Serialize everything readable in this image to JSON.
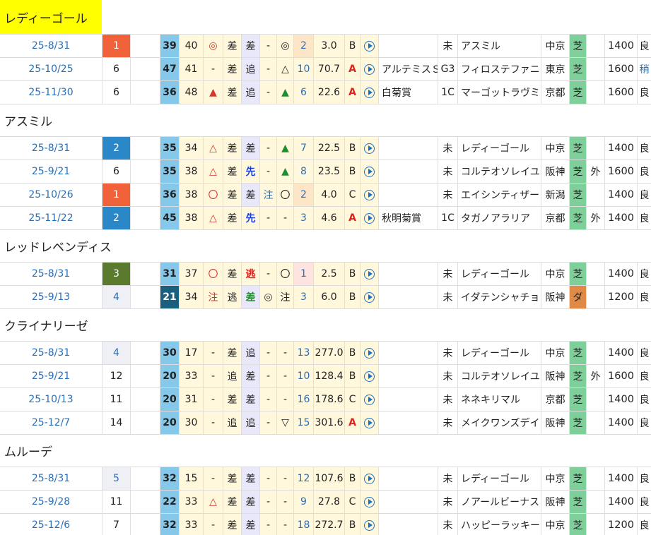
{
  "colors": {
    "rank_1": "#f2623a",
    "rank_2": "#2a87c8",
    "rank_3": "#5a7a2e",
    "rank_4_bg": "#eef0f5",
    "rank_5_bg": "#eef0f5",
    "idx_light": "#86c8ea",
    "idx_dark": "#1b5f7f",
    "turf": "#7fcf9a",
    "dirt": "#e08a45"
  },
  "groups": [
    {
      "name": "レディーゴール",
      "highlight": true,
      "rows": [
        {
          "date": "25-8/31",
          "rank": "1",
          "rank_style": "r1",
          "idx": "39",
          "idx_style": "light",
          "c2": "40",
          "m1": "◎",
          "m1c": "red",
          "m2": "差",
          "m3": "差",
          "m3c": "",
          "m4": "-",
          "m5": "◎",
          "m5c": "",
          "odds_rank": "2",
          "odds_bg": "peach",
          "odds": "3.0",
          "grade_letter": "B",
          "gl_red": false,
          "race": "",
          "cls": "未",
          "opponent": "アスミル",
          "venue": "中京",
          "surface": "芝",
          "surface_type": "turf",
          "course": "",
          "dist": "1400",
          "cond": "良"
        },
        {
          "date": "25-10/25",
          "rank": "6",
          "rank_style": "",
          "idx": "47",
          "idx_style": "light",
          "c2": "41",
          "m1": "-",
          "m1c": "",
          "m2": "差",
          "m3": "追",
          "m3c": "",
          "m4": "-",
          "m5": "△",
          "m5c": "",
          "odds_rank": "10",
          "odds_bg": "",
          "odds": "70.7",
          "grade_letter": "A",
          "gl_red": true,
          "race": "アルテミスＳ",
          "cls": "G3",
          "opponent": "フィロステファニ",
          "venue": "東京",
          "surface": "芝",
          "surface_type": "turf",
          "course": "",
          "dist": "1600",
          "cond": "稍"
        },
        {
          "date": "25-11/30",
          "rank": "6",
          "rank_style": "",
          "idx": "36",
          "idx_style": "light",
          "c2": "48",
          "m1": "▲",
          "m1c": "red",
          "m2": "差",
          "m3": "追",
          "m3c": "",
          "m4": "-",
          "m5": "▲",
          "m5c": "green",
          "odds_rank": "6",
          "odds_bg": "",
          "odds": "22.6",
          "grade_letter": "A",
          "gl_red": true,
          "race": "白菊賞",
          "cls": "1C",
          "opponent": "マーゴットラヴミー",
          "venue": "京都",
          "surface": "芝",
          "surface_type": "turf",
          "course": "",
          "dist": "1600",
          "cond": "良"
        }
      ]
    },
    {
      "name": "アスミル",
      "highlight": false,
      "rows": [
        {
          "date": "25-8/31",
          "rank": "2",
          "rank_style": "r2",
          "idx": "35",
          "idx_style": "light",
          "c2": "34",
          "m1": "△",
          "m1c": "red",
          "m2": "差",
          "m3": "差",
          "m3c": "",
          "m4": "-",
          "m5": "▲",
          "m5c": "green",
          "odds_rank": "7",
          "odds_bg": "",
          "odds": "22.5",
          "grade_letter": "B",
          "gl_red": false,
          "race": "",
          "cls": "未",
          "opponent": "レディーゴール",
          "venue": "中京",
          "surface": "芝",
          "surface_type": "turf",
          "course": "",
          "dist": "1400",
          "cond": "良"
        },
        {
          "date": "25-9/21",
          "rank": "6",
          "rank_style": "",
          "idx": "35",
          "idx_style": "light",
          "c2": "38",
          "m1": "△",
          "m1c": "red",
          "m2": "差",
          "m3": "先",
          "m3c": "blue",
          "m4": "-",
          "m5": "▲",
          "m5c": "green",
          "odds_rank": "8",
          "odds_bg": "",
          "odds": "23.5",
          "grade_letter": "B",
          "gl_red": false,
          "race": "",
          "cls": "未",
          "opponent": "コルテオソレイユ",
          "venue": "阪神",
          "surface": "芝",
          "surface_type": "turf",
          "course": "外",
          "dist": "1600",
          "cond": "良"
        },
        {
          "date": "25-10/26",
          "rank": "1",
          "rank_style": "r1",
          "idx": "36",
          "idx_style": "light",
          "c2": "38",
          "m1": "〇",
          "m1c": "red",
          "m2": "差",
          "m3": "差",
          "m3c": "",
          "m4": "注",
          "m5": "〇",
          "m5c": "",
          "odds_rank": "2",
          "odds_bg": "peach",
          "odds": "4.0",
          "grade_letter": "C",
          "gl_red": false,
          "race": "",
          "cls": "未",
          "opponent": "エイシンティザー",
          "venue": "新潟",
          "surface": "芝",
          "surface_type": "turf",
          "course": "",
          "dist": "1400",
          "cond": "良"
        },
        {
          "date": "25-11/22",
          "rank": "2",
          "rank_style": "r2",
          "idx": "45",
          "idx_style": "light",
          "c2": "38",
          "m1": "△",
          "m1c": "red",
          "m2": "差",
          "m3": "先",
          "m3c": "blue",
          "m4": "-",
          "m5": "-",
          "m5c": "",
          "odds_rank": "3",
          "odds_bg": "",
          "odds": "4.6",
          "grade_letter": "A",
          "gl_red": true,
          "race": "秋明菊賞",
          "cls": "1C",
          "opponent": "タガノアラリア",
          "venue": "京都",
          "surface": "芝",
          "surface_type": "turf",
          "course": "外",
          "dist": "1400",
          "cond": "良"
        }
      ]
    },
    {
      "name": "レッドレベンディス",
      "highlight": false,
      "rows": [
        {
          "date": "25-8/31",
          "rank": "3",
          "rank_style": "r3",
          "idx": "31",
          "idx_style": "light",
          "c2": "37",
          "m1": "〇",
          "m1c": "red",
          "m2": "差",
          "m3": "逃",
          "m3c": "boldred",
          "m4": "-",
          "m5": "〇",
          "m5c": "",
          "odds_rank": "1",
          "odds_bg": "pink",
          "odds": "2.5",
          "grade_letter": "B",
          "gl_red": false,
          "race": "",
          "cls": "未",
          "opponent": "レディーゴール",
          "venue": "中京",
          "surface": "芝",
          "surface_type": "turf",
          "course": "",
          "dist": "1400",
          "cond": "良"
        },
        {
          "date": "25-9/13",
          "rank": "4",
          "rank_style": "r4",
          "idx": "21",
          "idx_style": "dark",
          "c2": "34",
          "m1": "注",
          "m1c": "red",
          "m2": "逃",
          "m3": "差",
          "m3c": "boldgreen",
          "m4": "◎",
          "m5": "注",
          "m5c": "",
          "odds_rank": "3",
          "odds_bg": "",
          "odds": "6.0",
          "grade_letter": "B",
          "gl_red": false,
          "race": "",
          "cls": "未",
          "opponent": "イダテンシャチョウ",
          "venue": "阪神",
          "surface": "ダ",
          "surface_type": "dirt",
          "course": "",
          "dist": "1200",
          "cond": "良"
        }
      ]
    },
    {
      "name": "クライナリーゼ",
      "highlight": false,
      "rows": [
        {
          "date": "25-8/31",
          "rank": "4",
          "rank_style": "r4",
          "idx": "30",
          "idx_style": "light",
          "c2": "17",
          "m1": "-",
          "m1c": "",
          "m2": "差",
          "m3": "追",
          "m3c": "",
          "m4": "-",
          "m5": "-",
          "m5c": "",
          "odds_rank": "13",
          "odds_bg": "",
          "odds": "277.0",
          "grade_letter": "B",
          "gl_red": false,
          "race": "",
          "cls": "未",
          "opponent": "レディーゴール",
          "venue": "中京",
          "surface": "芝",
          "surface_type": "turf",
          "course": "",
          "dist": "1400",
          "cond": "良"
        },
        {
          "date": "25-9/21",
          "rank": "12",
          "rank_style": "",
          "idx": "20",
          "idx_style": "light",
          "c2": "33",
          "m1": "-",
          "m1c": "",
          "m2": "追",
          "m3": "差",
          "m3c": "",
          "m4": "-",
          "m5": "-",
          "m5c": "",
          "odds_rank": "10",
          "odds_bg": "",
          "odds": "128.4",
          "grade_letter": "B",
          "gl_red": false,
          "race": "",
          "cls": "未",
          "opponent": "コルテオソレイユ",
          "venue": "阪神",
          "surface": "芝",
          "surface_type": "turf",
          "course": "外",
          "dist": "1600",
          "cond": "良"
        },
        {
          "date": "25-10/13",
          "rank": "11",
          "rank_style": "",
          "idx": "20",
          "idx_style": "light",
          "c2": "31",
          "m1": "-",
          "m1c": "",
          "m2": "差",
          "m3": "差",
          "m3c": "",
          "m4": "-",
          "m5": "-",
          "m5c": "",
          "odds_rank": "16",
          "odds_bg": "",
          "odds": "178.6",
          "grade_letter": "C",
          "gl_red": false,
          "race": "",
          "cls": "未",
          "opponent": "ネネキリマル",
          "venue": "京都",
          "surface": "芝",
          "surface_type": "turf",
          "course": "",
          "dist": "1400",
          "cond": "良"
        },
        {
          "date": "25-12/7",
          "rank": "14",
          "rank_style": "",
          "idx": "20",
          "idx_style": "light",
          "c2": "30",
          "m1": "-",
          "m1c": "",
          "m2": "追",
          "m3": "追",
          "m3c": "",
          "m4": "-",
          "m5": "▽",
          "m5c": "",
          "odds_rank": "15",
          "odds_bg": "",
          "odds": "301.6",
          "grade_letter": "A",
          "gl_red": true,
          "race": "",
          "cls": "未",
          "opponent": "メイクワンズデイ",
          "venue": "阪神",
          "surface": "芝",
          "surface_type": "turf",
          "course": "",
          "dist": "1400",
          "cond": "良"
        }
      ]
    },
    {
      "name": "ムルーデ",
      "highlight": false,
      "rows": [
        {
          "date": "25-8/31",
          "rank": "5",
          "rank_style": "r4",
          "idx": "32",
          "idx_style": "light",
          "c2": "15",
          "m1": "-",
          "m1c": "",
          "m2": "差",
          "m3": "差",
          "m3c": "",
          "m4": "-",
          "m5": "-",
          "m5c": "",
          "odds_rank": "12",
          "odds_bg": "",
          "odds": "107.6",
          "grade_letter": "B",
          "gl_red": false,
          "race": "",
          "cls": "未",
          "opponent": "レディーゴール",
          "venue": "中京",
          "surface": "芝",
          "surface_type": "turf",
          "course": "",
          "dist": "1400",
          "cond": "良"
        },
        {
          "date": "25-9/28",
          "rank": "11",
          "rank_style": "",
          "idx": "22",
          "idx_style": "light",
          "c2": "33",
          "m1": "△",
          "m1c": "red",
          "m2": "差",
          "m3": "差",
          "m3c": "",
          "m4": "-",
          "m5": "-",
          "m5c": "",
          "odds_rank": "9",
          "odds_bg": "",
          "odds": "27.8",
          "grade_letter": "C",
          "gl_red": false,
          "race": "",
          "cls": "未",
          "opponent": "ノアールビーナス",
          "venue": "阪神",
          "surface": "芝",
          "surface_type": "turf",
          "course": "",
          "dist": "1400",
          "cond": "良"
        },
        {
          "date": "25-12/6",
          "rank": "7",
          "rank_style": "",
          "idx": "32",
          "idx_style": "light",
          "c2": "33",
          "m1": "-",
          "m1c": "",
          "m2": "差",
          "m3": "差",
          "m3c": "",
          "m4": "-",
          "m5": "-",
          "m5c": "",
          "odds_rank": "18",
          "odds_bg": "",
          "odds": "272.7",
          "grade_letter": "B",
          "gl_red": false,
          "race": "",
          "cls": "未",
          "opponent": "ハッピーラッキー",
          "venue": "中京",
          "surface": "芝",
          "surface_type": "turf",
          "course": "",
          "dist": "1200",
          "cond": "良"
        }
      ]
    }
  ]
}
